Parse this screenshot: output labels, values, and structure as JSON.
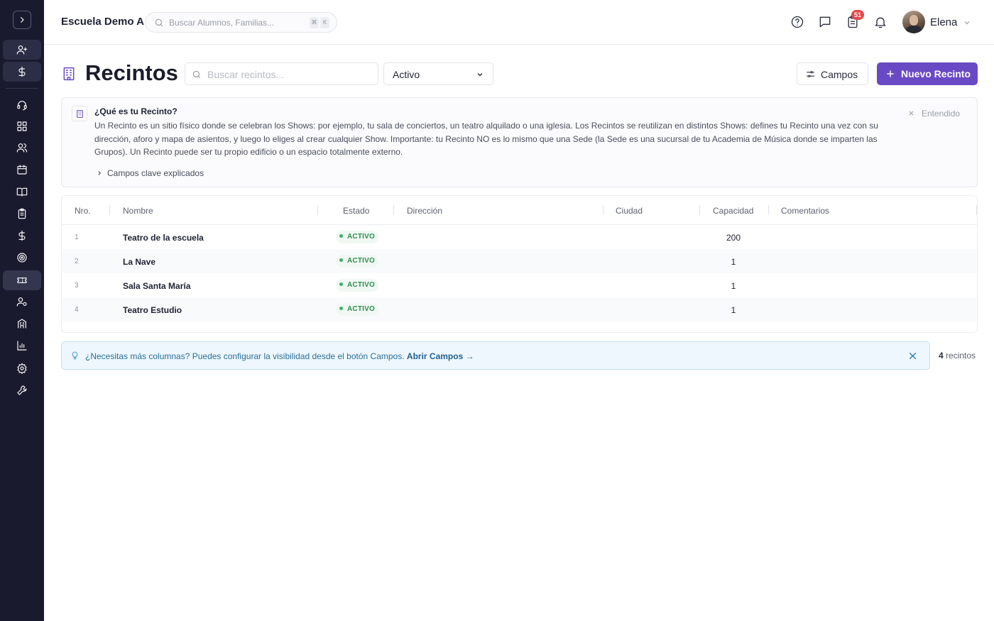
{
  "topbar": {
    "school_name": "Escuela Demo A",
    "search_placeholder": "Buscar Alumnos, Familias...",
    "shortcut_keys": [
      "⌘",
      "K"
    ],
    "tasks_badge": "51",
    "user_name": "Elena"
  },
  "sidebar": {
    "icons": [
      "chevron-right-icon",
      "user-plus-icon",
      "dollar-icon",
      "headset-icon",
      "dashboard-icon",
      "users-icon",
      "calendar-icon",
      "book-icon",
      "clipboard-icon",
      "dollar-icon",
      "target-icon",
      "ticket-icon",
      "user-settings-icon",
      "building-icon",
      "chart-icon",
      "gear-icon",
      "wrench-icon"
    ],
    "active": "ticket-icon"
  },
  "header": {
    "title": "Recintos",
    "search_placeholder": "Buscar recintos...",
    "filter_value": "Activo",
    "fields_button": "Campos",
    "new_button": "Nuevo Recinto"
  },
  "info": {
    "title": "¿Qué es tu Recinto?",
    "text": "Un Recinto es un sitio físico donde se celebran los Shows: por ejemplo, tu sala de conciertos, un teatro alquilado o una iglesia. Los Recintos se reutilizan en distintos Shows: defines tu Recinto una vez con su dirección, aforo y mapa de asientos, y luego lo eliges al crear cualquier Show. Importante: tu Recinto NO es lo mismo que una Sede (la Sede es una sucursal de tu Academia de Música donde se imparten las Grupos). Un Recinto puede ser tu propio edificio o un espacio totalmente externo.",
    "dismiss": "Entendido",
    "expander": "Campos clave explicados"
  },
  "table": {
    "columns": [
      "Nro.",
      "Nombre",
      "Estado",
      "Dirección",
      "Ciudad",
      "Capacidad",
      "Comentarios"
    ],
    "rows": [
      {
        "nr": "1",
        "nombre": "Teatro de la escuela",
        "estado": "ACTIVO",
        "direccion": "",
        "ciudad": "",
        "capacidad": "200",
        "comentarios": ""
      },
      {
        "nr": "2",
        "nombre": "La Nave",
        "estado": "ACTIVO",
        "direccion": "",
        "ciudad": "",
        "capacidad": "1",
        "comentarios": ""
      },
      {
        "nr": "3",
        "nombre": "Sala Santa María",
        "estado": "ACTIVO",
        "direccion": "",
        "ciudad": "",
        "capacidad": "1",
        "comentarios": ""
      },
      {
        "nr": "4",
        "nombre": "Teatro Estudio",
        "estado": "ACTIVO",
        "direccion": "",
        "ciudad": "",
        "capacidad": "1",
        "comentarios": ""
      }
    ]
  },
  "hint": {
    "message": "¿Necesitas más columnas? Puedes configurar la visibilidad desde el botón Campos.",
    "link": "Abrir Campos →"
  },
  "footer": {
    "count_number": "4",
    "count_label": "recintos"
  },
  "colors": {
    "sidebar_bg": "#191a2e",
    "accent": "#6a49c4",
    "status_green": "#2f8d4e",
    "badge_red": "#e34a4a",
    "hint_blue": "#2a6f9a"
  }
}
